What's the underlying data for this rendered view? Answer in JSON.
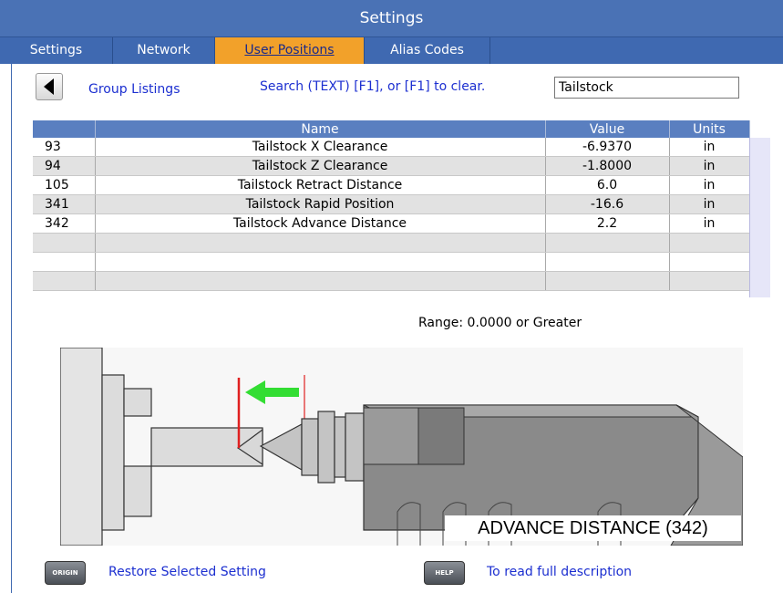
{
  "window": {
    "title": "Settings"
  },
  "tabs": [
    {
      "label": "Settings"
    },
    {
      "label": "Network"
    },
    {
      "label": "User Positions"
    },
    {
      "label": "Alias Codes"
    }
  ],
  "toolbar": {
    "back_icon": "back-triangle-icon",
    "group_listings": "Group Listings",
    "search_hint": "Search (TEXT) [F1], or [F1] to clear.",
    "search_value": "Tailstock"
  },
  "table": {
    "headers": [
      "",
      "Name",
      "Value",
      "Units"
    ],
    "rows": [
      {
        "num": "93",
        "name": "Tailstock X Clearance",
        "value": "-6.9370",
        "units": "in"
      },
      {
        "num": "94",
        "name": "Tailstock Z Clearance",
        "value": "-1.8000",
        "units": "in"
      },
      {
        "num": "105",
        "name": "Tailstock Retract Distance",
        "value": "6.0",
        "units": "in"
      },
      {
        "num": "341",
        "name": "Tailstock Rapid Position",
        "value": "-16.6",
        "units": "in"
      },
      {
        "num": "342",
        "name": "Tailstock Advance Distance",
        "value": "2.2",
        "units": "in"
      }
    ]
  },
  "range_text": "Range: 0.0000 or Greater",
  "diagram": {
    "label": "ADVANCE DISTANCE (342)"
  },
  "footer": {
    "origin_key": "ORIGIN",
    "origin_text": "Restore Selected Setting",
    "help_key": "HELP",
    "help_text": "To read full description"
  },
  "colors": {
    "title_bar": "#4a72b5",
    "tab_active": "#f2a12a",
    "link": "#1c2fd0",
    "arrow": "#33dd33",
    "limit_line": "#e02020"
  }
}
